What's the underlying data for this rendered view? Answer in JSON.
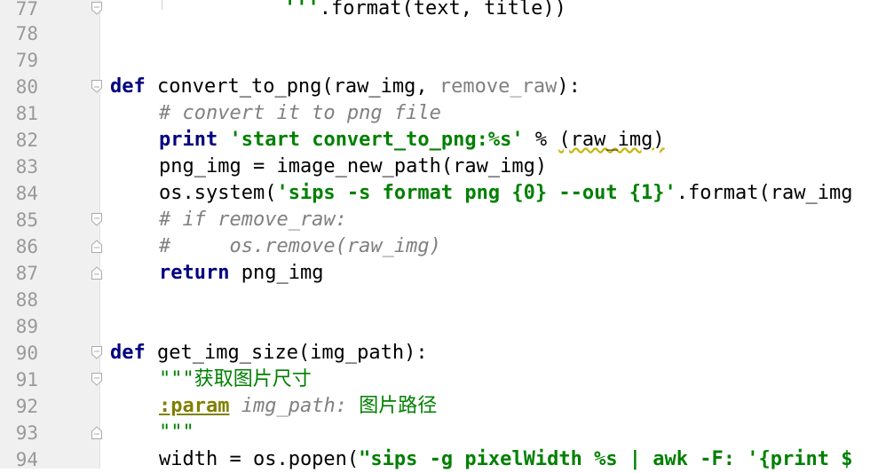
{
  "editor": {
    "line_numbers": [
      "77",
      "78",
      "79",
      "80",
      "81",
      "82",
      "83",
      "84",
      "85",
      "86",
      "87",
      "88",
      "89",
      "90",
      "91",
      "92",
      "93",
      "94"
    ],
    "code": {
      "l77_s1": "'''",
      "l77_s2": ".format(text, title))",
      "l80_kw": "def",
      "l80_s1": " convert_to_png(raw_img, ",
      "l80_s2": "remove_raw",
      "l80_s3": "):",
      "l81_cm": "# convert it to png file",
      "l82_kw": "print",
      "l82_s1": " ",
      "l82_str": "'start convert_to_png:%s'",
      "l82_s2": " % ",
      "l82_s3": "(raw_img)",
      "l83": "png_img = image_new_path(raw_img)",
      "l84_s1": "os.system(",
      "l84_str": "'sips -s format png {0} --out {1}'",
      "l84_s2": ".format(raw_img",
      "l85_cm": "# if remove_raw:",
      "l86_cm": "#     os.remove(raw_img)",
      "l87_kw": "return",
      "l87_s1": " png_img",
      "l90_kw": "def",
      "l90_s1": " get_img_size(img_path):",
      "l91_doc": "\"\"\"获取图片尺寸",
      "l92_tag": ":param",
      "l92_s1": " ",
      "l92_param": "img_path:",
      "l92_doc": " 图片路径",
      "l93_doc": "\"\"\"",
      "l94_s1": "width = os.popen(",
      "l94_str": "\"sips -g pixelWidth %s | awk -F: '{print $"
    },
    "colors": {
      "keyword": "#000080",
      "string": "#008000",
      "comment": "#808080",
      "docstring_tag": "#808000",
      "line_number": "#999999",
      "gutter": "#f0f0f0"
    }
  }
}
